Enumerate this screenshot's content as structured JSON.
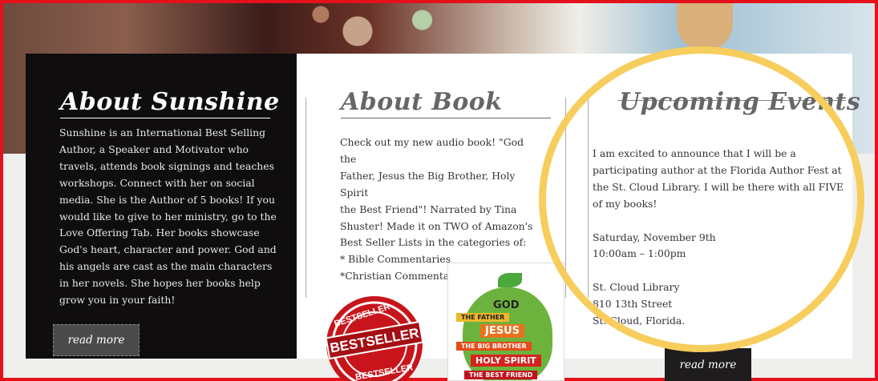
{
  "about_sunshine": {
    "title": "About Sunshine",
    "body": "Sunshine is an International  Best Selling  Author,  a Speaker and Motivator who travels,  attends book signings and teaches workshops. Connect with her on social media. She is the Author of 5 books! If you would like to give to her ministry, go to the Love Offering Tab. Her books showcase God's  heart, character and power. God and his angels are cast as the main characters in her novels. She hopes her books help grow you in your faith!",
    "read_more": "read more"
  },
  "about_book": {
    "title": "About Book",
    "lines": [
      "Check out my new audio book! \"God the",
      "Father, Jesus the Big Brother, Holy Spirit",
      "the Best Friend\"! Narrated by Tina",
      "Shuster!  Made it on TWO of  Amazon's",
      "Best Seller Lists  in the categories of:",
      "* Bible Commentaries",
      "*Christian Commentaries"
    ],
    "badge_text_top": "BESTSELLER",
    "badge_text_main": "BESTSELLER",
    "badge_text_bottom": "BESTSELLER",
    "cover": {
      "god": "GOD",
      "the_father": "THE FATHER",
      "jesus": "JESUS",
      "big_brother": "THE BIG BROTHER",
      "holy_spirit": "HOLY SPIRIT",
      "best_friend": "THE BEST FRIEND"
    }
  },
  "upcoming_events": {
    "title": "Upcoming Events",
    "intro": "I am excited to announce that I will be a participating author at the Florida Author Fest at the St. Cloud Library. I will be there with all FIVE of my books!",
    "date": "Saturday, November 9th",
    "time": "10:00am – 1:00pm",
    "venue": "St. Cloud Library",
    "street": "810 13th Street",
    "city": "St. Cloud, Florida.",
    "read_more": "read more"
  },
  "colors": {
    "frame_border": "#e4111b",
    "highlight_circle": "#f7cd5d",
    "dark_panel": "#0f0d0e"
  }
}
